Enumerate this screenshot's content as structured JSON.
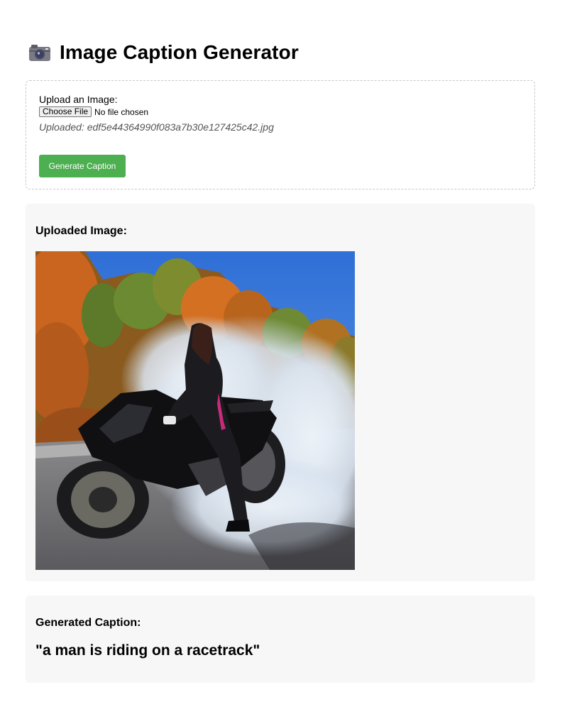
{
  "header": {
    "title": "Image Caption Generator",
    "icon": "camera-icon"
  },
  "upload": {
    "label": "Upload an Image:",
    "choose_button": "Choose File",
    "file_status": "No file chosen",
    "uploaded_text": "Uploaded: edf5e44364990f083a7b30e127425c42.jpg",
    "generate_button": "Generate Caption",
    "generate_color": "#4caf50"
  },
  "image_section": {
    "heading": "Uploaded Image:"
  },
  "caption_section": {
    "heading": "Generated Caption:",
    "caption": "\"a man is riding on a racetrack\""
  }
}
